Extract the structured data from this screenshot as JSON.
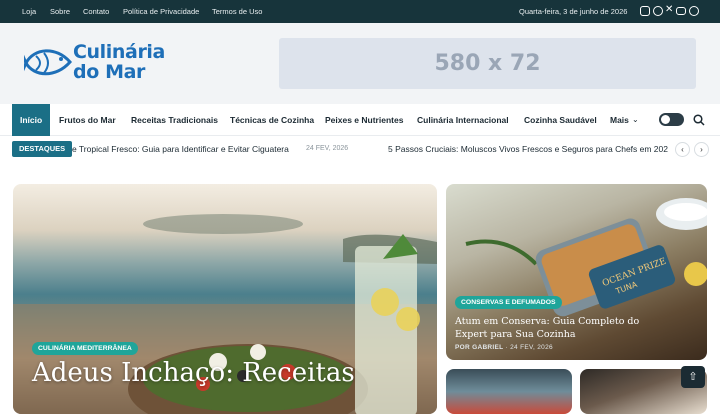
{
  "topbar": {
    "links": [
      "Loja",
      "Sobre",
      "Contato",
      "Política de Privacidade",
      "Termos de Uso"
    ],
    "date": "Quarta-feira, 3 de junho de 2026",
    "social": [
      "instagram-icon",
      "facebook-icon",
      "x-icon",
      "youtube-icon",
      "tiktok-icon"
    ]
  },
  "logo": {
    "line1": "Culinária",
    "line2": "do Mar",
    "color": "#1e6fb8"
  },
  "ad": {
    "label": "580 x 72"
  },
  "nav": {
    "items": [
      "Início",
      "Frutos do Mar",
      "Receitas Tradicionais",
      "Técnicas de Cozinha",
      "Peixes e Nutrientes",
      "Culinária Internacional",
      "Cozinha Saudável",
      "Mais"
    ],
    "accent": "#1b6f86"
  },
  "ticker": {
    "label": "DESTAQUES",
    "items": [
      {
        "text": "e Tropical Fresco: Guia para Identificar e Evitar Ciguatera",
        "date": "24 FEV, 2026"
      },
      {
        "text": "5 Passos Cruciais: Moluscos Vivos Frescos e Seguros para Chefs em 202"
      }
    ]
  },
  "featured": {
    "category": "CULINÁRIA MEDITERRÂNEA",
    "title": "Adeus Inchaço: Receitas"
  },
  "side": {
    "category": "CONSERVAS E DEFUMADOS",
    "title": "Atum em Conserva: Guia Completo do Expert para Sua Cozinha",
    "author": "POR GABRIEL",
    "date": "24 FEV, 2026",
    "can_label_1": "OCEAN PRIZE",
    "can_label_2": "TUNA"
  },
  "badge_color": "#1fa59a"
}
